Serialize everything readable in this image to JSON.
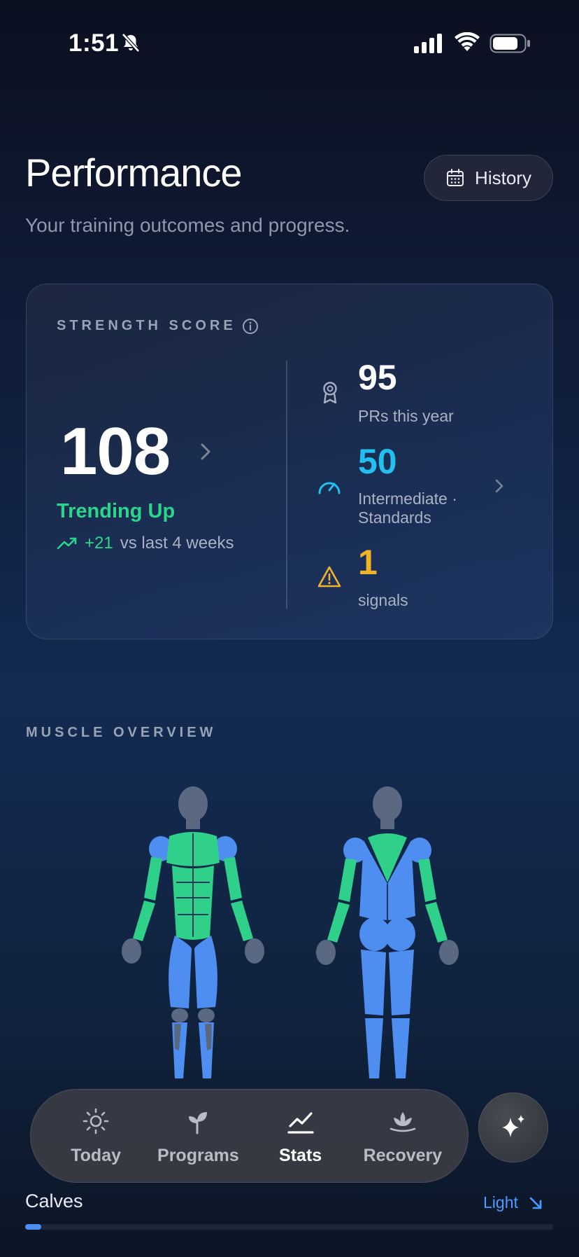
{
  "status_bar": {
    "time": "1:51"
  },
  "header": {
    "title": "Performance",
    "subtitle": "Your training outcomes and progress.",
    "history_label": "History"
  },
  "strength_card": {
    "label": "STRENGTH SCORE",
    "score": "108",
    "trend_label": "Trending Up",
    "trend_delta": "+21",
    "trend_suffix": "vs last 4 weeks",
    "stats": [
      {
        "value": "95",
        "label": "PRs this year",
        "icon": "award-icon",
        "color": "#ffffff"
      },
      {
        "value": "50",
        "label_line1": "Intermediate ·",
        "label_line2": "Standards",
        "icon": "gauge-icon",
        "color": "#22c0ee"
      },
      {
        "value": "1",
        "label": "signals",
        "icon": "warning-icon",
        "color": "#f0b429"
      }
    ]
  },
  "muscle_overview": {
    "title": "MUSCLE OVERVIEW",
    "colors": {
      "trained": "#2fd089",
      "light": "#4d8ef0",
      "neutral": "#5a6882"
    }
  },
  "tabbar": {
    "tabs": [
      {
        "label": "Today",
        "icon": "sun-icon"
      },
      {
        "label": "Programs",
        "icon": "sprout-icon"
      },
      {
        "label": "Stats",
        "icon": "chart-line-icon",
        "active": true
      },
      {
        "label": "Recovery",
        "icon": "lotus-icon"
      }
    ]
  },
  "muscle_list": {
    "items": [
      {
        "name": "Calves",
        "status": "Light",
        "level": 0.03
      }
    ]
  }
}
